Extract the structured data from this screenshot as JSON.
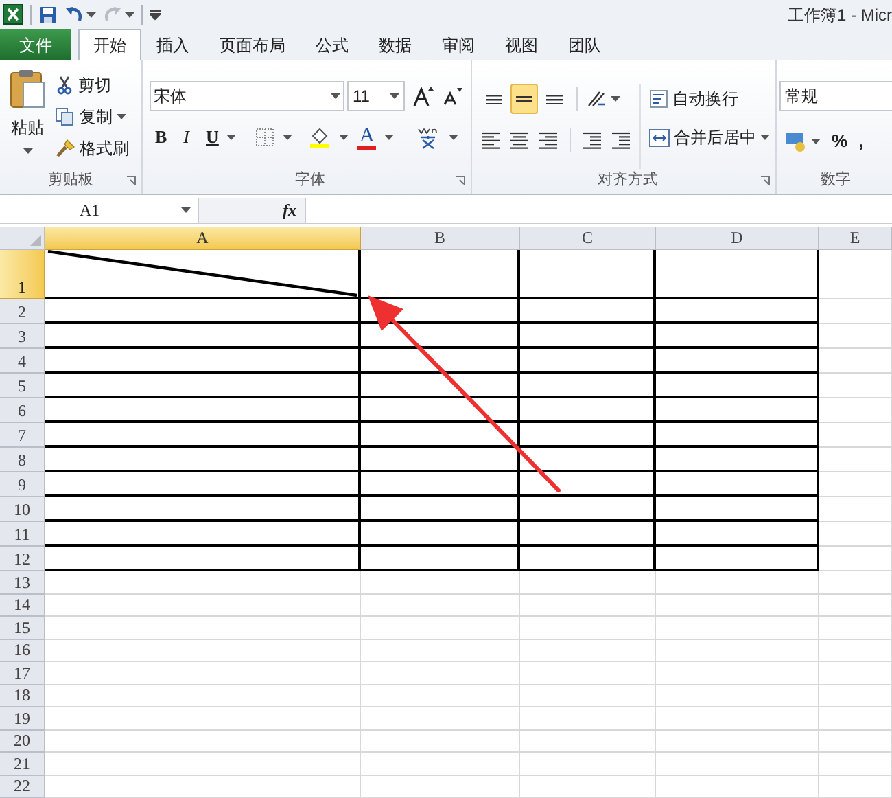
{
  "quick_access": [
    {
      "kind": "save",
      "disabled": false
    },
    {
      "kind": "undo",
      "disabled": false
    },
    {
      "kind": "redo",
      "disabled": true
    }
  ],
  "window": {
    "title": "工作簿1 - Micr"
  },
  "tabs": [
    {
      "label": "文件",
      "kind": "file",
      "selected": false
    },
    {
      "label": "开始",
      "kind": "tab",
      "selected": true
    },
    {
      "label": "插入",
      "kind": "tab",
      "selected": false
    },
    {
      "label": "页面布局",
      "kind": "tab",
      "selected": false
    },
    {
      "label": "公式",
      "kind": "tab",
      "selected": false
    },
    {
      "label": "数据",
      "kind": "tab",
      "selected": false
    },
    {
      "label": "审阅",
      "kind": "tab",
      "selected": false
    },
    {
      "label": "视图",
      "kind": "tab",
      "selected": false
    },
    {
      "label": "团队",
      "kind": "tab",
      "selected": false
    }
  ],
  "clipboard": {
    "label": "剪贴板",
    "paste": "粘贴",
    "items": [
      {
        "kind": "cut",
        "label": "剪切"
      },
      {
        "kind": "copy",
        "label": "复制"
      },
      {
        "kind": "painter",
        "label": "格式刷"
      }
    ]
  },
  "font": {
    "label": "字体",
    "font_name": "宋体",
    "font_size": "11",
    "bold": "B",
    "italic": "I",
    "underline": "U",
    "font_color": "A"
  },
  "alignment": {
    "label": "对齐方式",
    "vertical": [
      {
        "kind": "top",
        "selected": false
      },
      {
        "kind": "middle",
        "selected": true
      },
      {
        "kind": "bottom",
        "selected": false
      }
    ],
    "wrap_text": "自动换行",
    "merge_center": "合并后居中"
  },
  "number": {
    "label": "数字",
    "format": "常规",
    "symbols": [
      "%",
      ","
    ]
  },
  "formula_bar": {
    "name_box": "A1",
    "function_label": "fx"
  },
  "sheet": {
    "diagonal_in_first_cell": true,
    "columns": [
      {
        "label": "A",
        "selected": true,
        "bordered": true
      },
      {
        "label": "B",
        "selected": false,
        "bordered": true
      },
      {
        "label": "C",
        "selected": false,
        "bordered": true
      },
      {
        "label": "D",
        "selected": false,
        "bordered": true
      },
      {
        "label": "E",
        "selected": false,
        "bordered": false
      }
    ],
    "rows": [
      {
        "label": "1",
        "selected": true,
        "bordered": true
      },
      {
        "label": "2",
        "selected": false,
        "bordered": true
      },
      {
        "label": "3",
        "selected": false,
        "bordered": true
      },
      {
        "label": "4",
        "selected": false,
        "bordered": true
      },
      {
        "label": "5",
        "selected": false,
        "bordered": true
      },
      {
        "label": "6",
        "selected": false,
        "bordered": true
      },
      {
        "label": "7",
        "selected": false,
        "bordered": true
      },
      {
        "label": "8",
        "selected": false,
        "bordered": true
      },
      {
        "label": "9",
        "selected": false,
        "bordered": true
      },
      {
        "label": "10",
        "selected": false,
        "bordered": true
      },
      {
        "label": "11",
        "selected": false,
        "bordered": true
      },
      {
        "label": "12",
        "selected": false,
        "bordered": true
      },
      {
        "label": "13",
        "selected": false,
        "bordered": false
      },
      {
        "label": "14",
        "selected": false,
        "bordered": false
      },
      {
        "label": "15",
        "selected": false,
        "bordered": false
      },
      {
        "label": "16",
        "selected": false,
        "bordered": false
      },
      {
        "label": "17",
        "selected": false,
        "bordered": false
      },
      {
        "label": "18",
        "selected": false,
        "bordered": false
      },
      {
        "label": "19",
        "selected": false,
        "bordered": false
      },
      {
        "label": "20",
        "selected": false,
        "bordered": false
      },
      {
        "label": "21",
        "selected": false,
        "bordered": false
      },
      {
        "label": "22",
        "selected": false,
        "bordered": false
      }
    ]
  }
}
